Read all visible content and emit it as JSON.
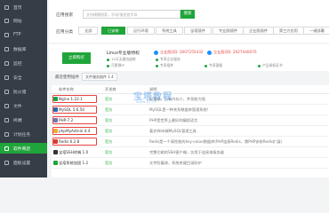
{
  "sidebar": {
    "items": [
      {
        "label": "首页"
      },
      {
        "label": "网站"
      },
      {
        "label": "FTP"
      },
      {
        "label": "数据库"
      },
      {
        "label": "监控"
      },
      {
        "label": "安全"
      },
      {
        "label": "防火墙"
      },
      {
        "label": "文件"
      },
      {
        "label": "终端"
      },
      {
        "label": "计划任务"
      },
      {
        "label": "软件商店"
      },
      {
        "label": "面板设置"
      }
    ],
    "active_index": 10,
    "active_color": "#20a53a"
  },
  "search": {
    "label": "应用搜索",
    "placeholder": "支持模糊搜索，字母/描述首字母",
    "button": "搜索"
  },
  "filters": {
    "label": "应用分类",
    "items": [
      "全部",
      "已安装",
      "运行环境",
      "系统工具",
      "宝塔插件",
      "专业版插件",
      "企业版插件",
      "第三方应用",
      "一键部署"
    ],
    "active_index": 1
  },
  "banner": {
    "buy_button": "立即购买",
    "title": "Linux专业版特权",
    "features": [
      "15天无理由退款",
      "可更换IP",
      "专享企业服务",
      "专享插件",
      "专享客服",
      "产品授权证书"
    ],
    "qq_1": "企业版QQ: 3007255432",
    "qq_2": "企业版QQ: 2927440070"
  },
  "recent": {
    "label": "最近使用插件",
    "chip": "文件服务插件 1.4"
  },
  "table": {
    "headers": [
      "软件名称",
      "开发商",
      "说明"
    ],
    "rows": [
      {
        "name": "Nginx 1.22.1",
        "dev": "官方",
        "desc": "轻量级，占有内存少，并发能力强",
        "icon_color": "#1aa34a",
        "highlight": true
      },
      {
        "name": "MySQL 5.6.50",
        "dev": "官方",
        "desc": "MySQL是一种关系数据库管理系统!",
        "icon_color": "#2a6aa8",
        "highlight": true
      },
      {
        "name": "PHP-7.2",
        "dev": "官方",
        "desc": "PHP是世界上最好的编程语言",
        "icon_color": "#6e79b4",
        "highlight": true
      },
      {
        "name": "phpMyAdmin 4.4",
        "dev": "官方",
        "desc": "著名Web端MySQL管理工具",
        "icon_color": "#f1a73a",
        "highlight": true
      },
      {
        "name": "Redis 6.2.8",
        "dev": "官方",
        "desc": "Redis是一个高性能的key-value数据库(PHP连接Redis，需PHP安装Redis扩展)",
        "icon_color": "#d63c2f",
        "highlight": true
      },
      {
        "name": "宝塔SSH终端 1.0",
        "dev": "官方",
        "desc": "完整功能的SSH客户端，仅用于连接本服务器",
        "icon_color": "#333333",
        "highlight": false
      },
      {
        "name": "宝塔系统加固 1.2",
        "dev": "官方",
        "desc": "文件防篡改，系统关键目录防护",
        "icon_color": "#20a53a",
        "highlight": false
      }
    ]
  },
  "watermark": {
    "main": "宝塔教程",
    "sub": "www.bt.cn"
  }
}
